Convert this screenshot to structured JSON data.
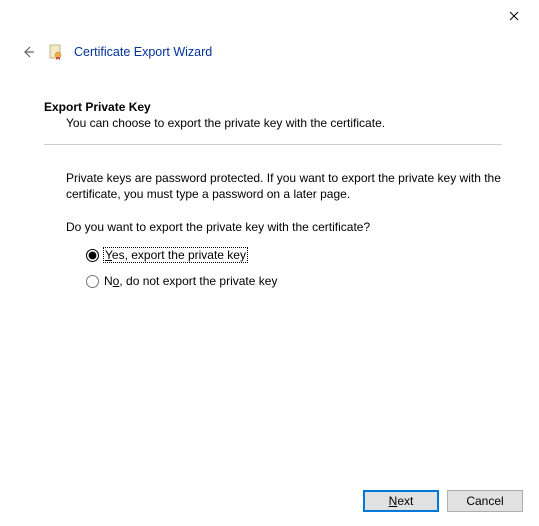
{
  "window": {
    "title": "Certificate Export Wizard"
  },
  "page": {
    "heading": "Export Private Key",
    "subheading": "You can choose to export the private key with the certificate.",
    "body": "Private keys are password protected. If you want to export the private key with the certificate, you must type a password on a later page.",
    "question": "Do you want to export the private key with the certificate?"
  },
  "options": {
    "yes": {
      "mnemonic": "Y",
      "rest": "es, export the private key",
      "checked": true
    },
    "no": {
      "mnemonic_pre": "N",
      "mnemonic": "o",
      "rest": ", do not export the private key",
      "checked": false
    }
  },
  "footer": {
    "next": {
      "mnemonic": "N",
      "rest": "ext"
    },
    "cancel": "Cancel"
  }
}
